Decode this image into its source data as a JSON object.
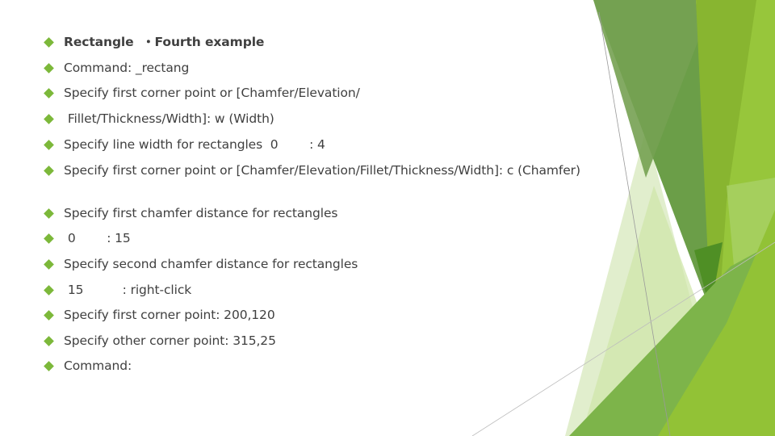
{
  "slide": {
    "accent_color": "#7cb83a",
    "text_color": "#404040",
    "bullets": [
      {
        "text": "Rectangle  ・Fourth example"
      },
      {
        "text": "Command: _rectang"
      },
      {
        "text": "Specify first corner point or [Chamfer/Elevation/"
      },
      {
        "text": " Fillet/Thickness/Width]: w (Width)"
      },
      {
        "text": "Specify line width for rectangles  0        : 4"
      },
      {
        "text": "Specify first corner point or [Chamfer/Elevation/Fillet/Thickness/Width]: c (Chamfer)"
      },
      {
        "text": "Specify first chamfer distance for rectangles"
      },
      {
        "text": " 0        : 15"
      },
      {
        "text": "Specify second chamfer distance for rectangles"
      },
      {
        "text": " 15          : right-click"
      },
      {
        "text": "Specify first corner point: 200,120"
      },
      {
        "text": "Specify other corner point: 315,25"
      },
      {
        "text": "Command:"
      }
    ]
  }
}
